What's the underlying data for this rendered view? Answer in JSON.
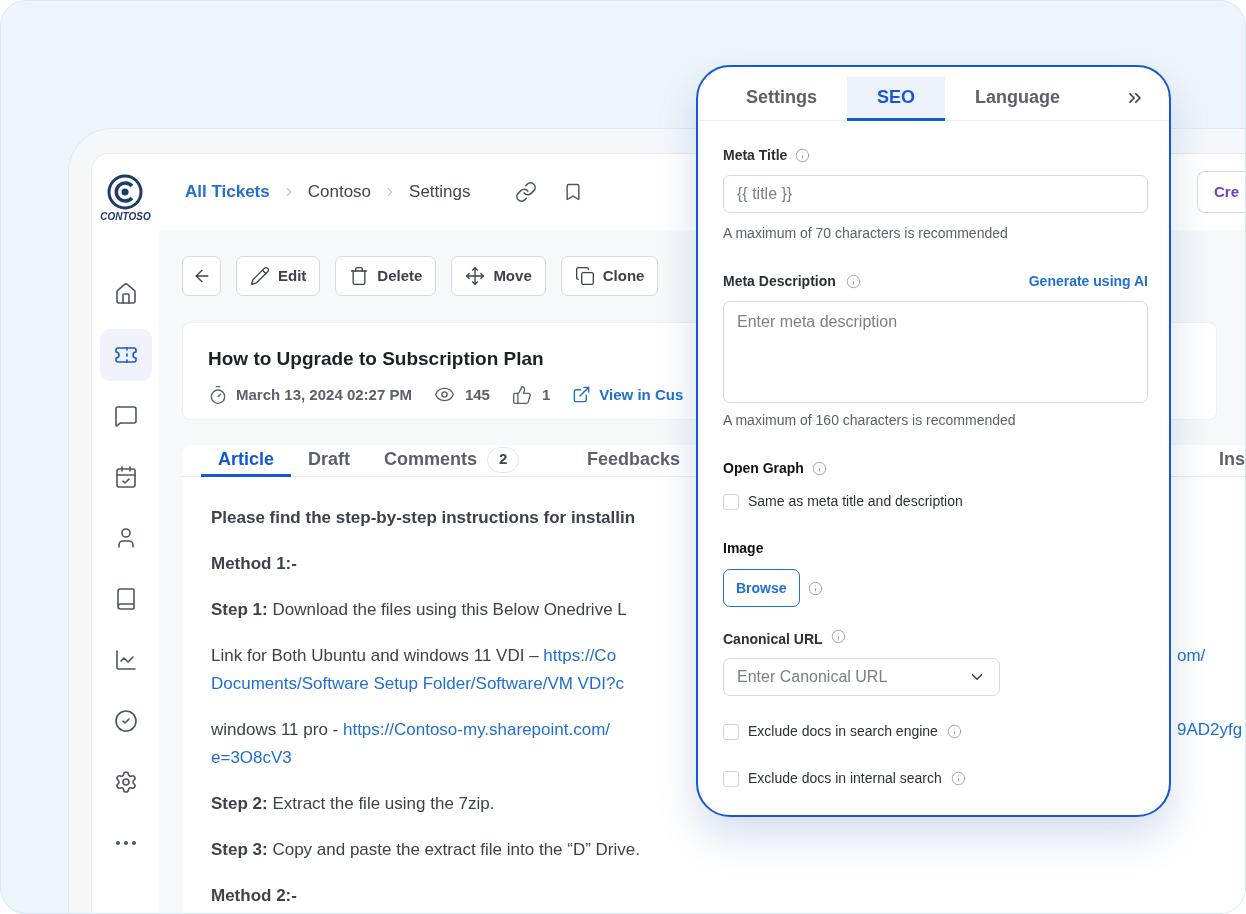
{
  "sidebar": {
    "logo": "CONTOSO",
    "items": [
      {
        "kind": "home",
        "selected": false
      },
      {
        "kind": "ticket",
        "selected": true
      },
      {
        "kind": "chat",
        "selected": false
      },
      {
        "kind": "calendar",
        "selected": false
      },
      {
        "kind": "user",
        "selected": false
      },
      {
        "kind": "book",
        "selected": false
      },
      {
        "kind": "chart",
        "selected": false
      },
      {
        "kind": "check",
        "selected": false
      },
      {
        "kind": "settings",
        "selected": false
      },
      {
        "kind": "more",
        "selected": false
      }
    ]
  },
  "breadcrumb": [
    "All Tickets",
    "Contoso",
    "Settings"
  ],
  "header_button": "Cre",
  "toolbar": [
    {
      "kind": "back"
    },
    {
      "kind": "edit",
      "label": "Edit"
    },
    {
      "kind": "delete",
      "label": "Delete"
    },
    {
      "kind": "move",
      "label": "Move"
    },
    {
      "kind": "clone",
      "label": "Clone"
    }
  ],
  "article": {
    "title": "How to Upgrade to Subscription Plan",
    "date": "March 13, 2024 02:27 PM",
    "views": "145",
    "likes": "1",
    "view_link": "View in Cus"
  },
  "tabs": [
    {
      "label": "Article",
      "selected": true
    },
    {
      "label": "Draft",
      "selected": false
    },
    {
      "label": "Comments",
      "badge": "2",
      "selected": false
    },
    {
      "label": "Feedbacks",
      "selected": false
    },
    {
      "label": "Ins",
      "selected": false
    }
  ],
  "body": [
    {
      "kind": "bold",
      "text": "Please find the step-by-step instructions for installin"
    },
    {
      "kind": "bold",
      "text": "Method 1:-"
    },
    {
      "kind": "step",
      "label": "Step 1:",
      "text": "Download the files using this Below Onedrive L"
    },
    {
      "kind": "link",
      "text": "Link for Both Ubuntu and windows 11 VDI – ",
      "link": "https://Co",
      "right": "om/",
      "link2": "Documents/Software Setup Folder/Software/VM VDI?c"
    },
    {
      "kind": "link",
      "text": "windows 11 pro - ",
      "link": "https://Contoso-my.sharepoint.com/",
      "right": "9AD2yfg",
      "link2": "e=3O8cV3"
    },
    {
      "kind": "step",
      "label": "Step 2:",
      "text": "Extract the file using the 7zip."
    },
    {
      "kind": "step",
      "label": "Step 3:",
      "text": "Copy and paste the extract file into the “D” Drive."
    },
    {
      "kind": "bold",
      "text": "Method 2:-"
    }
  ],
  "panel": {
    "tabs": [
      {
        "label": "Settings",
        "selected": false
      },
      {
        "label": "SEO",
        "selected": true
      },
      {
        "label": "Language",
        "selected": false
      }
    ],
    "meta_title": {
      "label": "Meta Title",
      "placeholder": "{{ title }}",
      "hint": "A maximum of 70 characters is recommended"
    },
    "meta_description": {
      "label": "Meta Description",
      "action": "Generate using AI",
      "placeholder": "Enter meta description",
      "hint": "A maximum of 160 characters is recommended"
    },
    "open_graph": {
      "label": "Open Graph",
      "option": {
        "label": "Same as meta title and description",
        "checked": false
      }
    },
    "image": {
      "label": "Image",
      "button": "Browse"
    },
    "canonical_url": {
      "label": "Canonical URL",
      "placeholder": "Enter Canonical URL"
    },
    "options": [
      {
        "label": "Exclude docs in search engine",
        "checked": false
      },
      {
        "label": "Exclude docs in internal search",
        "checked": false
      }
    ]
  }
}
